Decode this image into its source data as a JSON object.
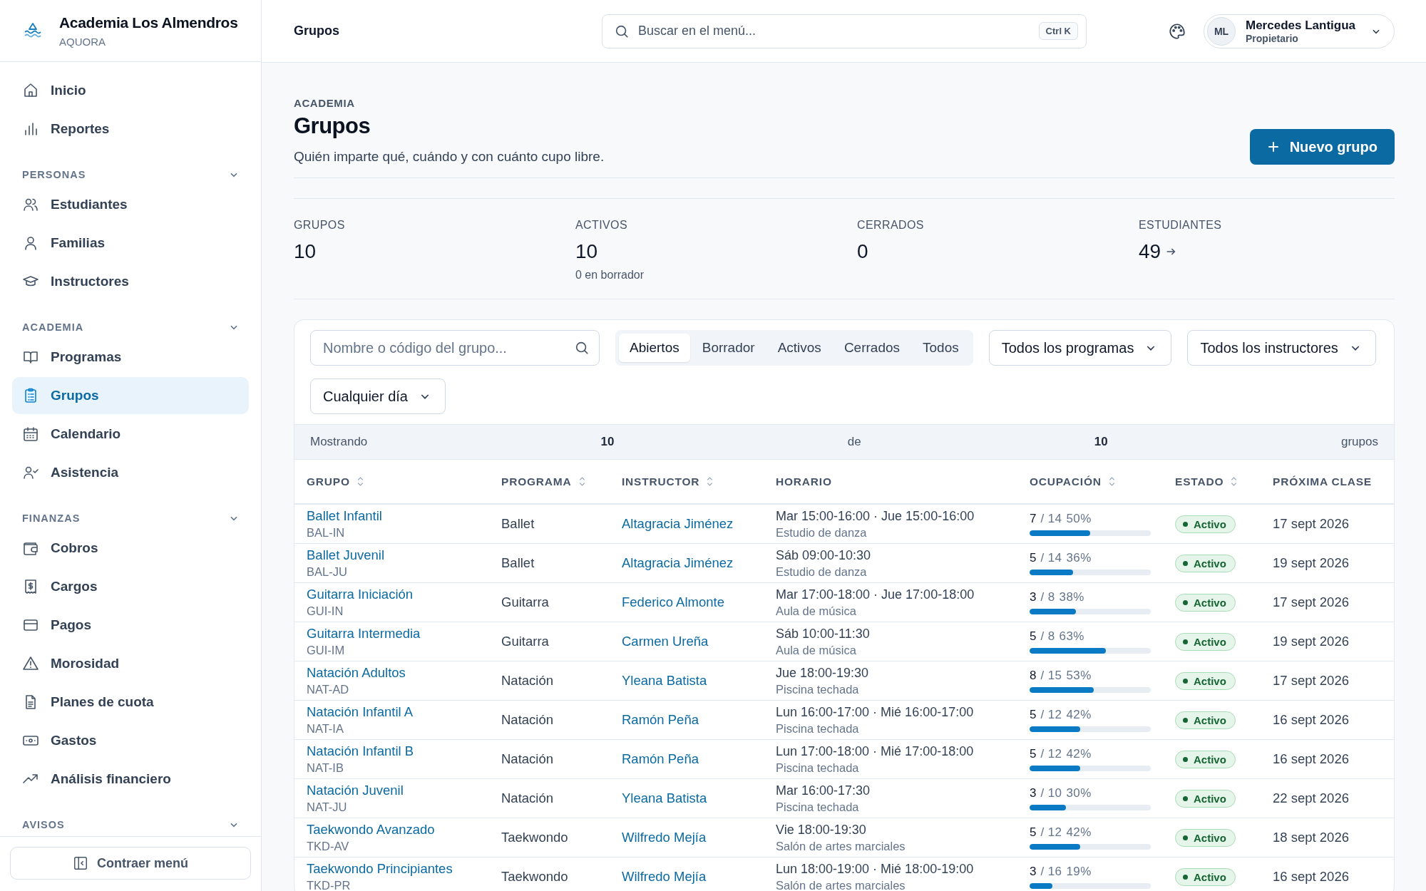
{
  "brand": {
    "name": "Academia Los Almendros",
    "product": "AQUORA"
  },
  "sidebar": {
    "sections": [
      {
        "items": [
          {
            "label": "Inicio",
            "selected": false
          },
          {
            "label": "Reportes",
            "selected": false
          }
        ]
      },
      {
        "title": "PERSONAS",
        "expanded": true,
        "items": [
          {
            "label": "Estudiantes",
            "selected": false
          },
          {
            "label": "Familias",
            "selected": false
          },
          {
            "label": "Instructores",
            "selected": false
          }
        ]
      },
      {
        "title": "ACADEMIA",
        "expanded": true,
        "items": [
          {
            "label": "Programas",
            "selected": false
          },
          {
            "label": "Grupos",
            "selected": true
          },
          {
            "label": "Calendario",
            "selected": false
          },
          {
            "label": "Asistencia",
            "selected": false
          }
        ]
      },
      {
        "title": "FINANZAS",
        "expanded": true,
        "items": [
          {
            "label": "Cobros",
            "selected": false
          },
          {
            "label": "Cargos",
            "selected": false
          },
          {
            "label": "Pagos",
            "selected": false
          },
          {
            "label": "Morosidad",
            "selected": false
          },
          {
            "label": "Planes de cuota",
            "selected": false
          },
          {
            "label": "Gastos",
            "selected": false
          },
          {
            "label": "Análisis financiero",
            "selected": false
          }
        ]
      },
      {
        "title": "AVISOS",
        "expanded": true
      }
    ],
    "collapse_button": "Contraer menú"
  },
  "topbar": {
    "title": "Grupos",
    "search": {
      "placeholder": "Buscar en el menú...",
      "shortcut": "Ctrl K"
    },
    "user": {
      "initials": "ML",
      "name": "Mercedes Lantigua",
      "role": "Propietario"
    }
  },
  "page": {
    "eyebrow": "ACADEMIA",
    "title": "Grupos",
    "subtitle": "Quién imparte qué, cuándo y con cuánto cupo libre.",
    "primary_button": "Nuevo grupo"
  },
  "stats": [
    {
      "label": "GRUPOS",
      "value": "10"
    },
    {
      "label": "ACTIVOS",
      "value": "10",
      "note": "0 en borrador"
    },
    {
      "label": "CERRADOS",
      "value": "0"
    },
    {
      "label": "ESTUDIANTES",
      "value": "49",
      "linked": true
    }
  ],
  "filters": {
    "search": {
      "placeholder": "Nombre o código del grupo..."
    },
    "tabs": [
      {
        "label": "Abiertos",
        "selected": true
      },
      {
        "label": "Borrador",
        "selected": false
      },
      {
        "label": "Activos",
        "selected": false
      },
      {
        "label": "Cerrados",
        "selected": false
      },
      {
        "label": "Todos",
        "selected": false
      }
    ],
    "dropdowns": [
      {
        "value": "Todos los programas"
      },
      {
        "value": "Todos los instructores"
      },
      {
        "value": "Cualquier día"
      }
    ]
  },
  "summary": [
    "Mostrando",
    "10",
    "de",
    "10",
    "grupos"
  ],
  "table": {
    "columns": [
      {
        "label": "GRUPO",
        "sortable": true
      },
      {
        "label": "PROGRAMA",
        "sortable": true
      },
      {
        "label": "INSTRUCTOR",
        "sortable": true
      },
      {
        "label": "HORARIO",
        "sortable": false
      },
      {
        "label": "OCUPACIÓN",
        "sortable": true
      },
      {
        "label": "ESTADO",
        "sortable": true
      },
      {
        "label": "PRÓXIMA CLASE",
        "sortable": false
      }
    ],
    "rows": [
      {
        "name": "Ballet Infantil",
        "code": "BAL-IN",
        "program": "Ballet",
        "instructor": "Altagracia Jiménez",
        "schedule": "Mar 15:00-16:00 · Jue 15:00-16:00",
        "place": "Estudio de danza",
        "enrolled": "7",
        "capacity": "/ 14",
        "percent": "50%",
        "level": 0.5,
        "status": {
          "label": "Activo",
          "kind": "active"
        },
        "next": "17 sept 2026"
      },
      {
        "name": "Ballet Juvenil",
        "code": "BAL-JU",
        "program": "Ballet",
        "instructor": "Altagracia Jiménez",
        "schedule": "Sáb 09:00-10:30",
        "place": "Estudio de danza",
        "enrolled": "5",
        "capacity": "/ 14",
        "percent": "36%",
        "level": 0.36,
        "status": {
          "label": "Activo",
          "kind": "active"
        },
        "next": "19 sept 2026"
      },
      {
        "name": "Guitarra Iniciación",
        "code": "GUI-IN",
        "program": "Guitarra",
        "instructor": "Federico Almonte",
        "schedule": "Mar 17:00-18:00 · Jue 17:00-18:00",
        "place": "Aula de música",
        "enrolled": "3",
        "capacity": "/ 8",
        "percent": "38%",
        "level": 0.38,
        "status": {
          "label": "Activo",
          "kind": "active"
        },
        "next": "17 sept 2026"
      },
      {
        "name": "Guitarra Intermedia",
        "code": "GUI-IM",
        "program": "Guitarra",
        "instructor": "Carmen Ureña",
        "schedule": "Sáb 10:00-11:30",
        "place": "Aula de música",
        "enrolled": "5",
        "capacity": "/ 8",
        "percent": "63%",
        "level": 0.63,
        "status": {
          "label": "Activo",
          "kind": "active"
        },
        "next": "19 sept 2026"
      },
      {
        "name": "Natación Adultos",
        "code": "NAT-AD",
        "program": "Natación",
        "instructor": "Yleana Batista",
        "schedule": "Jue 18:00-19:30",
        "place": "Piscina techada",
        "enrolled": "8",
        "capacity": "/ 15",
        "percent": "53%",
        "level": 0.53,
        "status": {
          "label": "Activo",
          "kind": "active"
        },
        "next": "17 sept 2026"
      },
      {
        "name": "Natación Infantil A",
        "code": "NAT-IA",
        "program": "Natación",
        "instructor": "Ramón Peña",
        "schedule": "Lun 16:00-17:00 · Mié 16:00-17:00",
        "place": "Piscina techada",
        "enrolled": "5",
        "capacity": "/ 12",
        "percent": "42%",
        "level": 0.42,
        "status": {
          "label": "Activo",
          "kind": "active"
        },
        "next": "16 sept 2026"
      },
      {
        "name": "Natación Infantil B",
        "code": "NAT-IB",
        "program": "Natación",
        "instructor": "Ramón Peña",
        "schedule": "Lun 17:00-18:00 · Mié 17:00-18:00",
        "place": "Piscina techada",
        "enrolled": "5",
        "capacity": "/ 12",
        "percent": "42%",
        "level": 0.42,
        "status": {
          "label": "Activo",
          "kind": "active"
        },
        "next": "16 sept 2026"
      },
      {
        "name": "Natación Juvenil",
        "code": "NAT-JU",
        "program": "Natación",
        "instructor": "Yleana Batista",
        "schedule": "Mar 16:00-17:30",
        "place": "Piscina techada",
        "enrolled": "3",
        "capacity": "/ 10",
        "percent": "30%",
        "level": 0.3,
        "status": {
          "label": "Activo",
          "kind": "active"
        },
        "next": "22 sept 2026"
      },
      {
        "name": "Taekwondo Avanzado",
        "code": "TKD-AV",
        "program": "Taekwondo",
        "instructor": "Wilfredo Mejía",
        "schedule": "Vie 18:00-19:30",
        "place": "Salón de artes marciales",
        "enrolled": "5",
        "capacity": "/ 12",
        "percent": "42%",
        "level": 0.42,
        "status": {
          "label": "Activo",
          "kind": "active"
        },
        "next": "18 sept 2026"
      },
      {
        "name": "Taekwondo Principiantes",
        "code": "TKD-PR",
        "program": "Taekwondo",
        "instructor": "Wilfredo Mejía",
        "schedule": "Lun 18:00-19:00 · Mié 18:00-19:00",
        "place": "Salón de artes marciales",
        "enrolled": "3",
        "capacity": "/ 16",
        "percent": "19%",
        "level": 0.19,
        "status": {
          "label": "Activo",
          "kind": "active"
        },
        "next": "16 sept 2026"
      }
    ]
  }
}
